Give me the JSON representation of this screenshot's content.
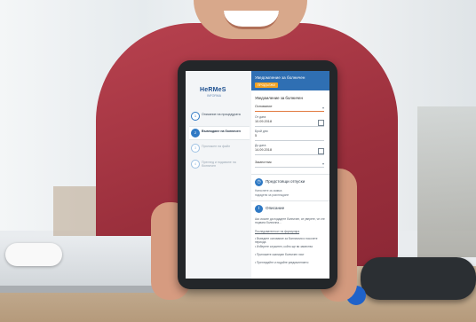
{
  "app": {
    "logo": "HeRMeS",
    "logo_sub": "INFORMA"
  },
  "steps": [
    {
      "num": "1",
      "label": "Описание на процедурата"
    },
    {
      "num": "2",
      "label": "Въвеждане на болничен"
    },
    {
      "num": "3",
      "label": "Приложен на файл"
    },
    {
      "num": "4",
      "label": "Преглед и подаване на болничен"
    }
  ],
  "header": {
    "title": "Уведомление за болничен",
    "button": "ПРОДЪЛЖИ"
  },
  "form": {
    "section_title": "Уведомление за болничен",
    "reason_label": "Основание",
    "from_label": "От дата",
    "from_value": "10.09.2018",
    "days_label": "Брой дни",
    "days_value": "5",
    "to_label": "До дата",
    "to_value": "14.09.2018",
    "replacement_label": "Заместник"
  },
  "panels": {
    "upcoming_title": "Предстоящи отпуски",
    "upcoming_sub_1": "Натиснете за заявка",
    "upcoming_sub_2": "подадени за разглеждане",
    "description_title": "Описание",
    "description_p1": "Ако искате да подадете болничен, се уверете, че сте първата болнична…",
    "description_p2": "Последователност на формуляра",
    "description_bullets": [
      "• Въведете основание за болничния и посочете периода",
      "• Изберете служител, който ще ви замества",
      "• Приложете сканиран болничен лист",
      "• Прегледайте и подайте уведомлението"
    ]
  }
}
